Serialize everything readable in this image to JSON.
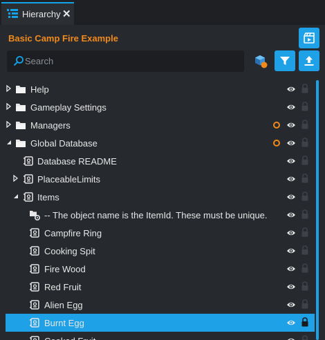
{
  "tab": {
    "title": "Hierarchy",
    "close": "✕"
  },
  "scene_title": "Basic Camp Fire Example",
  "search": {
    "placeholder": "Search",
    "value": ""
  },
  "colors": {
    "accent": "#1ea1e6",
    "orange": "#f08a1c",
    "background": "#26292e"
  },
  "tree": [
    {
      "label": "Help",
      "type": "folder",
      "arrow": "right",
      "modified": false
    },
    {
      "label": "Gameplay Settings",
      "type": "folder",
      "arrow": "right",
      "modified": false
    },
    {
      "label": "Managers",
      "type": "folder",
      "arrow": "right",
      "modified": true
    },
    {
      "label": "Global Database",
      "type": "folder",
      "arrow": "down",
      "modified": true
    },
    {
      "label": "Database README",
      "type": "script",
      "arrow": "none",
      "modified": false
    },
    {
      "label": "PlaceableLimits",
      "type": "script",
      "arrow": "right",
      "modified": false
    },
    {
      "label": "Items",
      "type": "script",
      "arrow": "down",
      "modified": false
    },
    {
      "label": "-- The object name is the ItemId. These must be unique.",
      "type": "group",
      "arrow": "none",
      "modified": false
    },
    {
      "label": "Campfire Ring",
      "type": "script",
      "arrow": "none",
      "modified": false
    },
    {
      "label": "Cooking Spit",
      "type": "script",
      "arrow": "none",
      "modified": false
    },
    {
      "label": "Fire Wood",
      "type": "script",
      "arrow": "none",
      "modified": false
    },
    {
      "label": "Red Fruit",
      "type": "script",
      "arrow": "none",
      "modified": false
    },
    {
      "label": "Alien Egg",
      "type": "script",
      "arrow": "none",
      "modified": false
    },
    {
      "label": "Burnt Egg",
      "type": "script",
      "arrow": "none",
      "modified": false,
      "selected": true
    },
    {
      "label": "Cooked Fruit",
      "type": "script",
      "arrow": "none",
      "modified": false
    }
  ]
}
